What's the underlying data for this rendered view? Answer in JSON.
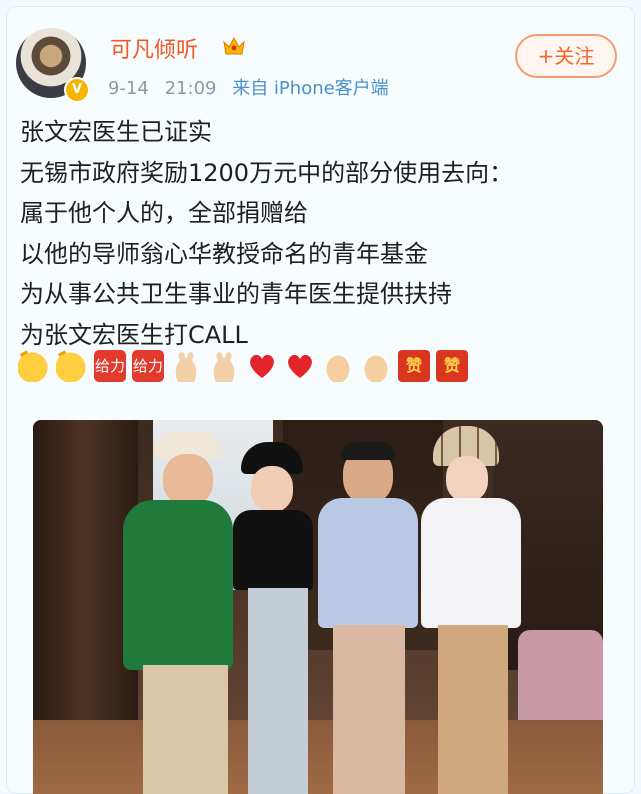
{
  "post": {
    "username": "可凡倾听",
    "crown_icon": "crown-icon",
    "verified_icon": "verified-badge-icon",
    "date": "9-14",
    "time": "21:09",
    "source": "来自 iPhone客户端",
    "follow_label": "+关注",
    "text_lines": [
      "张文宏医生已证实",
      "无锡市政府奖励1200万元中的部分使用去向：",
      "属于他个人的，全部捐赠给",
      "以他的导师翁心华教授命名的青年基金",
      "为从事公共卫生事业的青年医生提供扶持",
      "为张文宏医生打CALL"
    ],
    "emojis": [
      "clap-icon",
      "clap-icon",
      "awesome-stamp-icon",
      "awesome-stamp-icon",
      "victory-hand-icon",
      "victory-hand-icon",
      "red-heart-icon",
      "red-heart-icon",
      "pray-icon",
      "pray-icon",
      "zan-icon",
      "zan-icon"
    ],
    "emoji_stamp_text": "给力",
    "emoji_zan_text": "赞",
    "photo": "group-photo-four-people"
  },
  "colors": {
    "username": "#f15a24",
    "accent": "#f26a2b",
    "meta": "#8c9aa3",
    "background": "#f4fbfe"
  }
}
